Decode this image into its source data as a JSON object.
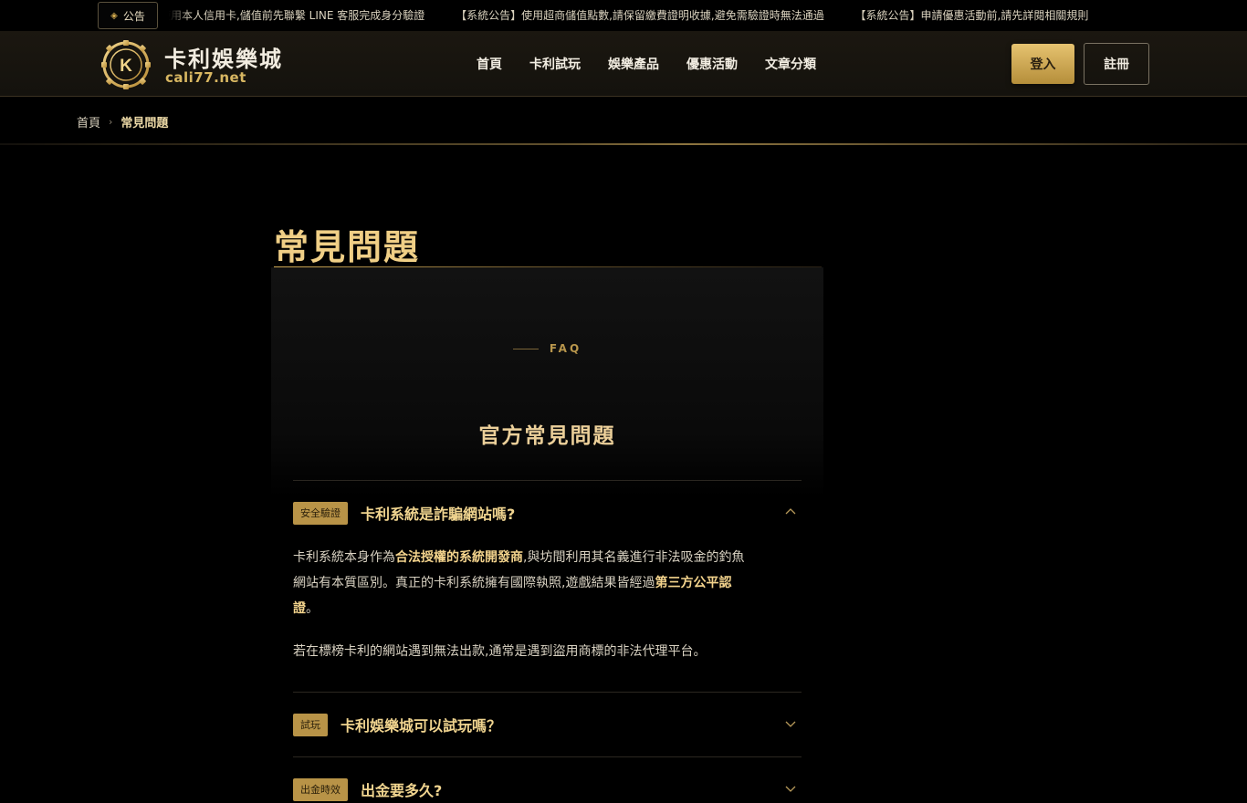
{
  "announcement": {
    "badge_label": "公告",
    "items": [
      "使用本人信用卡,儲值前先聯繫 LINE 客服完成身分驗證",
      "【系統公告】使用超商儲值點數,請保留繳費證明收據,避免需驗證時無法通過",
      "【系統公告】申請優惠活動前,請先詳閱相關規則"
    ]
  },
  "header": {
    "logo_letter": "K",
    "logo_name": "卡利娛樂城",
    "logo_domain": "cali77.net",
    "nav": [
      "首頁",
      "卡利試玩",
      "娛樂產品",
      "優惠活動",
      "文章分類"
    ],
    "login_label": "登入",
    "register_label": "註冊"
  },
  "breadcrumb": {
    "home": "首頁",
    "separator": "›",
    "current": "常見問題"
  },
  "page": {
    "title": "常見問題"
  },
  "faq": {
    "eyebrow": "FAQ",
    "heading": "官方常見問題",
    "items": [
      {
        "tag": "安全驗證",
        "question": "卡利系統是詐騙網站嗎?",
        "expanded": true,
        "answer": {
          "p1_a": "卡利系統本身作為",
          "p1_b": "合法授權的系統開發商",
          "p1_c": ",與坊間利用其名義進行非法吸金的釣魚網站有本質區別。真正的卡利系統擁有國際執照,遊戲結果皆經過",
          "p1_d": "第三方公平認證",
          "p1_e": "。",
          "p2": "若在標榜卡利的網站遇到無法出款,通常是遇到盜用商標的非法代理平台。"
        }
      },
      {
        "tag": "試玩",
        "question": "卡利娛樂城可以試玩嗎？",
        "expanded": false
      },
      {
        "tag": "出金時效",
        "question": "出金要多久?",
        "expanded": false
      }
    ]
  },
  "colors": {
    "gold": "#d4ac4f",
    "gold_light": "#f0cf86",
    "background": "#000000"
  }
}
